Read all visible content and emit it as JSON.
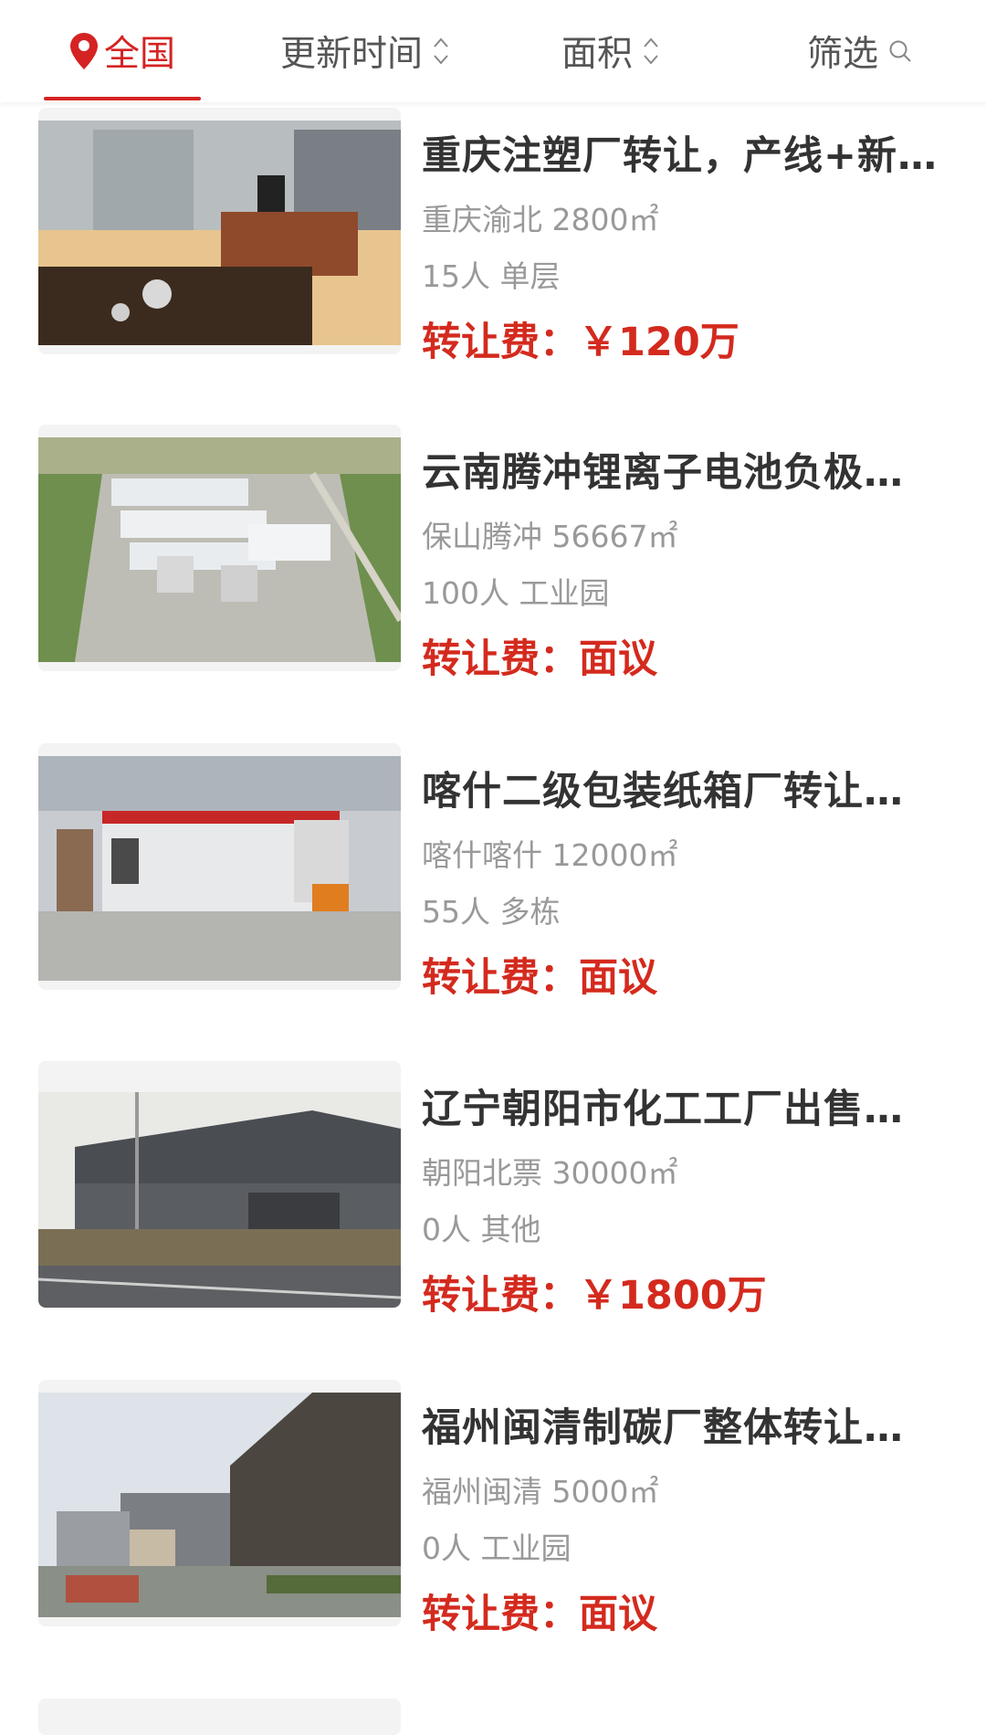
{
  "tabs": [
    {
      "label": "全国",
      "active": true,
      "icon": "location-pin-icon"
    },
    {
      "label": "更新时间",
      "icon": "sort-updown-icon"
    },
    {
      "label": "面积",
      "icon": "sort-updown-icon"
    },
    {
      "label": "筛选",
      "icon": "search-icon"
    }
  ],
  "colors": {
    "accent": "#d52323",
    "price": "#d42a1e",
    "title": "#333333",
    "sub": "#999999"
  },
  "listings": [
    {
      "title": "重庆注塑厂转让，产线+新…",
      "location": "重庆渝北 2800㎡",
      "meta": "15人 单层",
      "price_label": "转让费：",
      "price_value": "￥120万",
      "image": "office-interior-photo"
    },
    {
      "title": "云南腾冲锂离子电池负极…",
      "location": "保山腾冲 56667㎡",
      "meta": "100人 工业园",
      "price_label": "转让费：",
      "price_value": "面议",
      "image": "aerial-factory-photo"
    },
    {
      "title": "喀什二级包装纸箱厂转让…",
      "location": "喀什喀什 12000㎡",
      "meta": "55人 多栋",
      "price_label": "转让费：",
      "price_value": "面议",
      "image": "carton-machine-photo"
    },
    {
      "title": "辽宁朝阳市化工工厂出售…",
      "location": "朝阳北票 30000㎡",
      "meta": "0人 其他",
      "price_label": "转让费：",
      "price_value": "￥1800万",
      "image": "factory-building-photo"
    },
    {
      "title": "福州闽清制碳厂整体转让…",
      "location": "福州闽清 5000㎡",
      "meta": "0人 工业园",
      "price_label": "转让费：",
      "price_value": "面议",
      "image": "carbon-plant-photo"
    }
  ]
}
